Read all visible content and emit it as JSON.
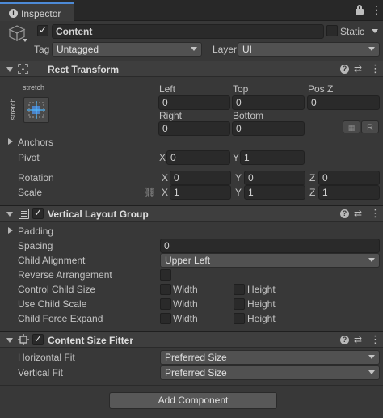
{
  "tab": {
    "title": "Inspector"
  },
  "gameobject": {
    "name": "Content",
    "static_label": "Static",
    "tag_label": "Tag",
    "tag_value": "Untagged",
    "layer_label": "Layer",
    "layer_value": "UI"
  },
  "rect_transform": {
    "title": "Rect Transform",
    "anchor_top": "stretch",
    "anchor_left": "stretch",
    "left_label": "Left",
    "left_value": "0",
    "top_label": "Top",
    "top_value": "0",
    "posz_label": "Pos Z",
    "posz_value": "0",
    "right_label": "Right",
    "right_value": "0",
    "bottom_label": "Bottom",
    "bottom_value": "0",
    "raw_edit_label": "R",
    "anchors_label": "Anchors",
    "pivot_label": "Pivot",
    "pivot_x": "0",
    "pivot_y": "1",
    "rotation_label": "Rotation",
    "rot_x": "0",
    "rot_y": "0",
    "rot_z": "0",
    "scale_label": "Scale",
    "scale_x": "1",
    "scale_y": "1",
    "scale_z": "1",
    "x": "X",
    "y": "Y",
    "z": "Z"
  },
  "vertical_layout": {
    "title": "Vertical Layout Group",
    "padding_label": "Padding",
    "spacing_label": "Spacing",
    "spacing_value": "0",
    "child_alignment_label": "Child Alignment",
    "child_alignment_value": "Upper Left",
    "reverse_label": "Reverse Arrangement",
    "control_label": "Control Child Size",
    "use_scale_label": "Use Child Scale",
    "force_expand_label": "Child Force Expand",
    "width": "Width",
    "height": "Height"
  },
  "content_size_fitter": {
    "title": "Content Size Fitter",
    "hfit_label": "Horizontal Fit",
    "hfit_value": "Preferred Size",
    "vfit_label": "Vertical Fit",
    "vfit_value": "Preferred Size"
  },
  "add_component": "Add Component",
  "colors": {
    "accent": "#4d8ad6",
    "panel": "#383838",
    "header": "#3e3e3e",
    "field": "#2a2a2a"
  }
}
